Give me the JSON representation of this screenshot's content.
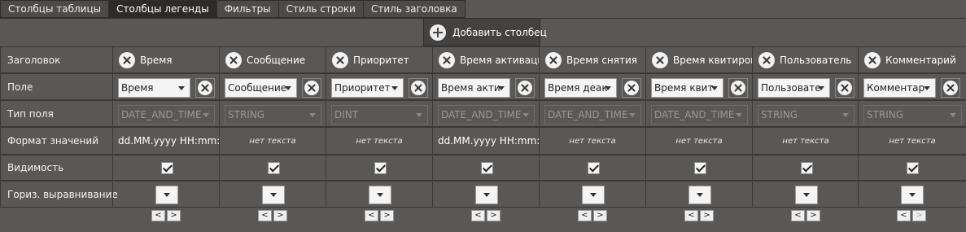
{
  "tabs": [
    "Столбцы таблицы",
    "Столбцы легенды",
    "Фильтры",
    "Стиль строки",
    "Стиль заголовка"
  ],
  "active_tab": 1,
  "add_button_label": "Добавить столбец",
  "row_labels": {
    "header": "Заголовок",
    "field": "Поле",
    "field_type": "Тип поля",
    "value_format": "Формат значений",
    "visibility": "Видимость",
    "h_align": "Гориз. выравнивание"
  },
  "nav": {
    "prev": "<",
    "next": ">"
  },
  "columns": [
    {
      "header": "Время",
      "field": "Время",
      "field_type": "DATE_AND_TIME",
      "format": "dd.MM.yyyy HH:mm:ss",
      "format_is_empty": false,
      "visible": true
    },
    {
      "header": "Сообщение",
      "field": "Сообщение",
      "field_type": "STRING",
      "format": "нет текста",
      "format_is_empty": true,
      "visible": true
    },
    {
      "header": "Приоритет",
      "field": "Приоритет",
      "field_type": "DINT",
      "format": "нет текста",
      "format_is_empty": true,
      "visible": true
    },
    {
      "header": "Время активации",
      "field": "Время акти",
      "field_type": "DATE_AND_TIME",
      "format": "dd.MM.yyyy HH:mm:ss",
      "format_is_empty": false,
      "visible": true
    },
    {
      "header": "Время снятия",
      "field": "Время деак",
      "field_type": "DATE_AND_TIME",
      "format": "нет текста",
      "format_is_empty": true,
      "visible": true
    },
    {
      "header": "Время квитирования",
      "field": "Время квит",
      "field_type": "DATE_AND_TIME",
      "format": "нет текста",
      "format_is_empty": true,
      "visible": true
    },
    {
      "header": "Пользователь",
      "field": "Пользовате",
      "field_type": "STRING",
      "format": "нет текста",
      "format_is_empty": true,
      "visible": true
    },
    {
      "header": "Комментарий",
      "field": "Комментар",
      "field_type": "STRING",
      "format": "нет текста",
      "format_is_empty": true,
      "visible": true
    }
  ]
}
